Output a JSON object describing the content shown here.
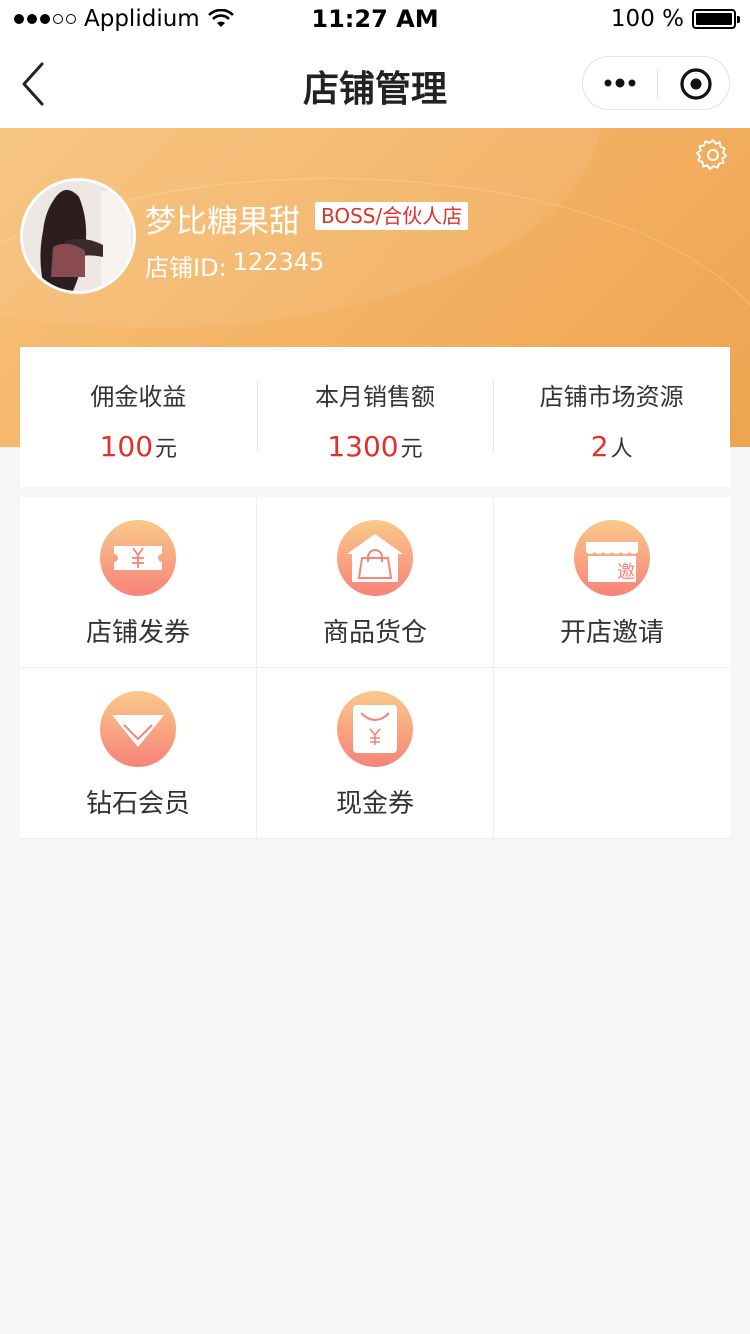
{
  "status_bar": {
    "carrier": "Applidium",
    "time": "11:27 AM",
    "battery": "100 %"
  },
  "nav": {
    "title": "店铺管理"
  },
  "profile": {
    "name": "梦比糖果甜",
    "badge": "BOSS/合伙人店",
    "id_label": "店铺ID:",
    "id_value": "122345"
  },
  "stats": [
    {
      "label": "佣金收益",
      "value": "100",
      "unit": "元"
    },
    {
      "label": "本月销售额",
      "value": "1300",
      "unit": "元"
    },
    {
      "label": "店铺市场资源",
      "value": "2",
      "unit": "人"
    }
  ],
  "menu": [
    {
      "label": "店铺发券",
      "icon": "coupon-icon"
    },
    {
      "label": "商品货仓",
      "icon": "warehouse-icon"
    },
    {
      "label": "开店邀请",
      "icon": "invite-store-icon",
      "icon_text": "邀"
    },
    {
      "label": "钻石会员",
      "icon": "diamond-icon"
    },
    {
      "label": "现金券",
      "icon": "cash-coupon-icon"
    }
  ],
  "colors": {
    "header_gradient_start": "#f7c27a",
    "header_gradient_end": "#eea450",
    "accent_red": "#e0322b",
    "icon_gradient_top": "#f9c98a",
    "icon_gradient_bottom": "#f7837a"
  }
}
